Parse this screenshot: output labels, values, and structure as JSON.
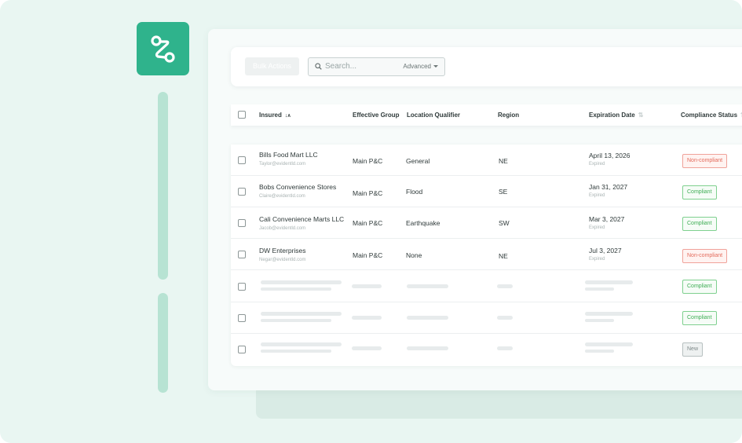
{
  "toolbar": {
    "bulk_label": "Bulk Actions",
    "search_placeholder": "Search...",
    "advanced_label": "Advanced"
  },
  "table": {
    "columns": {
      "insured": "Insured",
      "effective_group": "Effective Group",
      "location_qualifier": "Location Qualifier",
      "region": "Region",
      "expiration_date": "Expiration Date",
      "compliance_status": "Compliance Status"
    },
    "rows": [
      {
        "name": "Bills Food Mart LLC",
        "email": "Taylor@evidentld.com",
        "group": "Main P&C",
        "qualifier": "General",
        "region": "NE",
        "date": "April 13, 2026",
        "date_note": "Expired",
        "status": "Non-compliant"
      },
      {
        "name": "Bobs Convenience Stores",
        "email": "Claire@evidentld.com",
        "group": "Main P&C",
        "qualifier": "Flood",
        "region": "SE",
        "date": "Jan 31, 2027",
        "date_note": "Expired",
        "status": "Compliant"
      },
      {
        "name": "Cali Convenience Marts LLC",
        "email": "Jacob@evidentld.com",
        "group": "Main P&C",
        "qualifier": "Earthquake",
        "region": "SW",
        "date": "Mar 3, 2027",
        "date_note": "Expired",
        "status": "Compliant"
      },
      {
        "name": "DW Enterprises",
        "email": "Negar@evidentld.com",
        "group": "Main P&C",
        "qualifier": "None",
        "region": "NE",
        "date": "Jul 3, 2027",
        "date_note": "Expired",
        "status": "Non-compliant"
      }
    ],
    "placeholder_statuses": [
      "Compliant",
      "Compliant",
      "New"
    ]
  },
  "colors": {
    "brand": "#2fb38c",
    "compliant": "#3fae55",
    "non_compliant": "#e36a5b"
  },
  "icons": {
    "logo": "route-icon",
    "search": "search-icon",
    "sort": "sort-az-icon"
  }
}
